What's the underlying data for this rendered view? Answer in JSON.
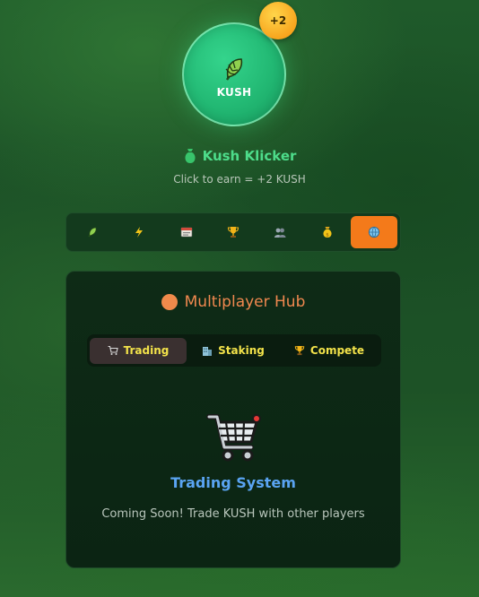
{
  "clicker": {
    "coin_label": "KUSH",
    "bonus_badge": "+2",
    "title": "Kush Klicker",
    "subtitle": "Click to earn = +2 KUSH"
  },
  "icon_tabs": [
    {
      "name": "leaf",
      "icon": "leaf-icon",
      "active": false
    },
    {
      "name": "upgrades",
      "icon": "lightning-icon",
      "active": false
    },
    {
      "name": "stats",
      "icon": "dashboard-icon",
      "active": false
    },
    {
      "name": "achievements",
      "icon": "trophy-icon",
      "active": false
    },
    {
      "name": "social",
      "icon": "people-icon",
      "active": false
    },
    {
      "name": "rewards",
      "icon": "money-bag-icon",
      "active": false
    },
    {
      "name": "multiplayer",
      "icon": "globe-icon",
      "active": true
    }
  ],
  "hub": {
    "title": "Multiplayer Hub",
    "tabs": [
      {
        "label": "Trading",
        "icon": "cart-icon",
        "active": true
      },
      {
        "label": "Staking",
        "icon": "building-icon",
        "active": false
      },
      {
        "label": "Compete",
        "icon": "trophy-icon",
        "active": false
      }
    ],
    "section_title": "Trading System",
    "section_desc": "Coming Soon! Trade KUSH with other players"
  },
  "colors": {
    "accent_orange": "#f47a1a",
    "title_green": "#4ddc8a",
    "trading_blue": "#5aa4f2",
    "tab_yellow": "#f2e24a"
  }
}
